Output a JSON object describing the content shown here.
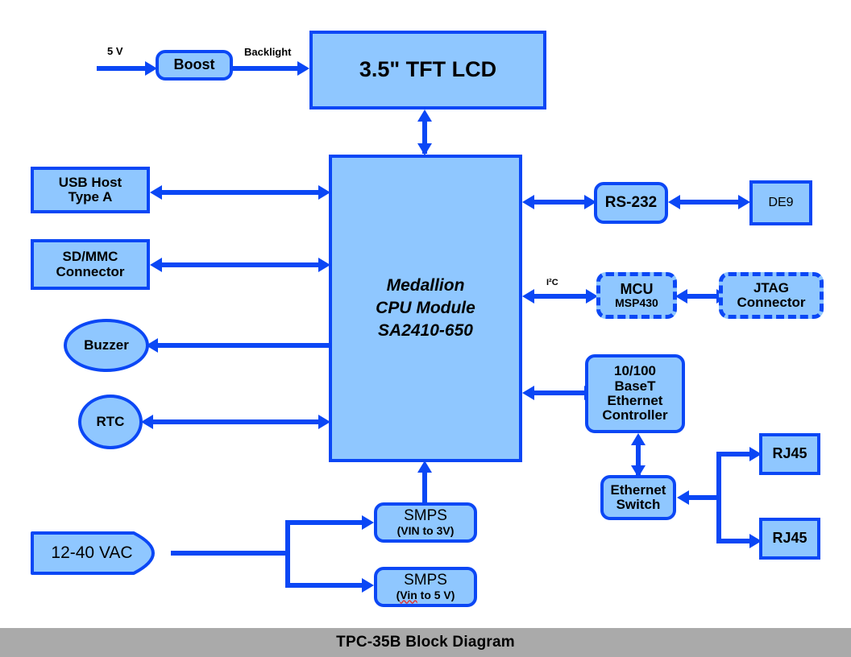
{
  "caption": {
    "text": "TPC-35B Block Diagram"
  },
  "theme": {
    "fill": "#8FC7FF",
    "stroke": "#0B47F5",
    "caption_bar": "#AAAAAA",
    "text": "#000000",
    "spellcheck_underline": "#E03030",
    "background": "#FFFFFF"
  },
  "blocks": {
    "boost": {
      "label": "Boost"
    },
    "lcd": {
      "label": "3.5\" TFT LCD"
    },
    "usb": {
      "line1": "USB Host",
      "line2": "Type A"
    },
    "sdmmc": {
      "line1": "SD/MMC",
      "line2": "Connector"
    },
    "buzzer": {
      "label": "Buzzer"
    },
    "rtc": {
      "label": "RTC"
    },
    "cpu": {
      "line1": "Medallion",
      "line2": "CPU Module",
      "line3": "SA2410-650"
    },
    "rs232": {
      "label": "RS-232"
    },
    "de9": {
      "label": "DE9"
    },
    "mcu": {
      "line1": "MCU",
      "line2": "MSP430"
    },
    "jtag": {
      "line1": "JTAG",
      "line2": "Connector"
    },
    "ethctl": {
      "line1": "10/100",
      "line2": "BaseT",
      "line3": "Ethernet",
      "line4": "Controller"
    },
    "ethsw": {
      "line1": "Ethernet",
      "line2": "Switch"
    },
    "rj45_1": {
      "label": "RJ45"
    },
    "rj45_2": {
      "label": "RJ45"
    },
    "smps3": {
      "line1": "SMPS",
      "line2": "(VIN to 3V)"
    },
    "smps5": {
      "line1": "SMPS",
      "line2_a": "(",
      "line2_b": "Vin",
      "line2_c": " to 5 V)"
    },
    "vac": {
      "label": "12-40 VAC"
    }
  },
  "edge_labels": {
    "five_volt": "5 V",
    "backlight": "Backlight",
    "i2c": "I²C"
  }
}
